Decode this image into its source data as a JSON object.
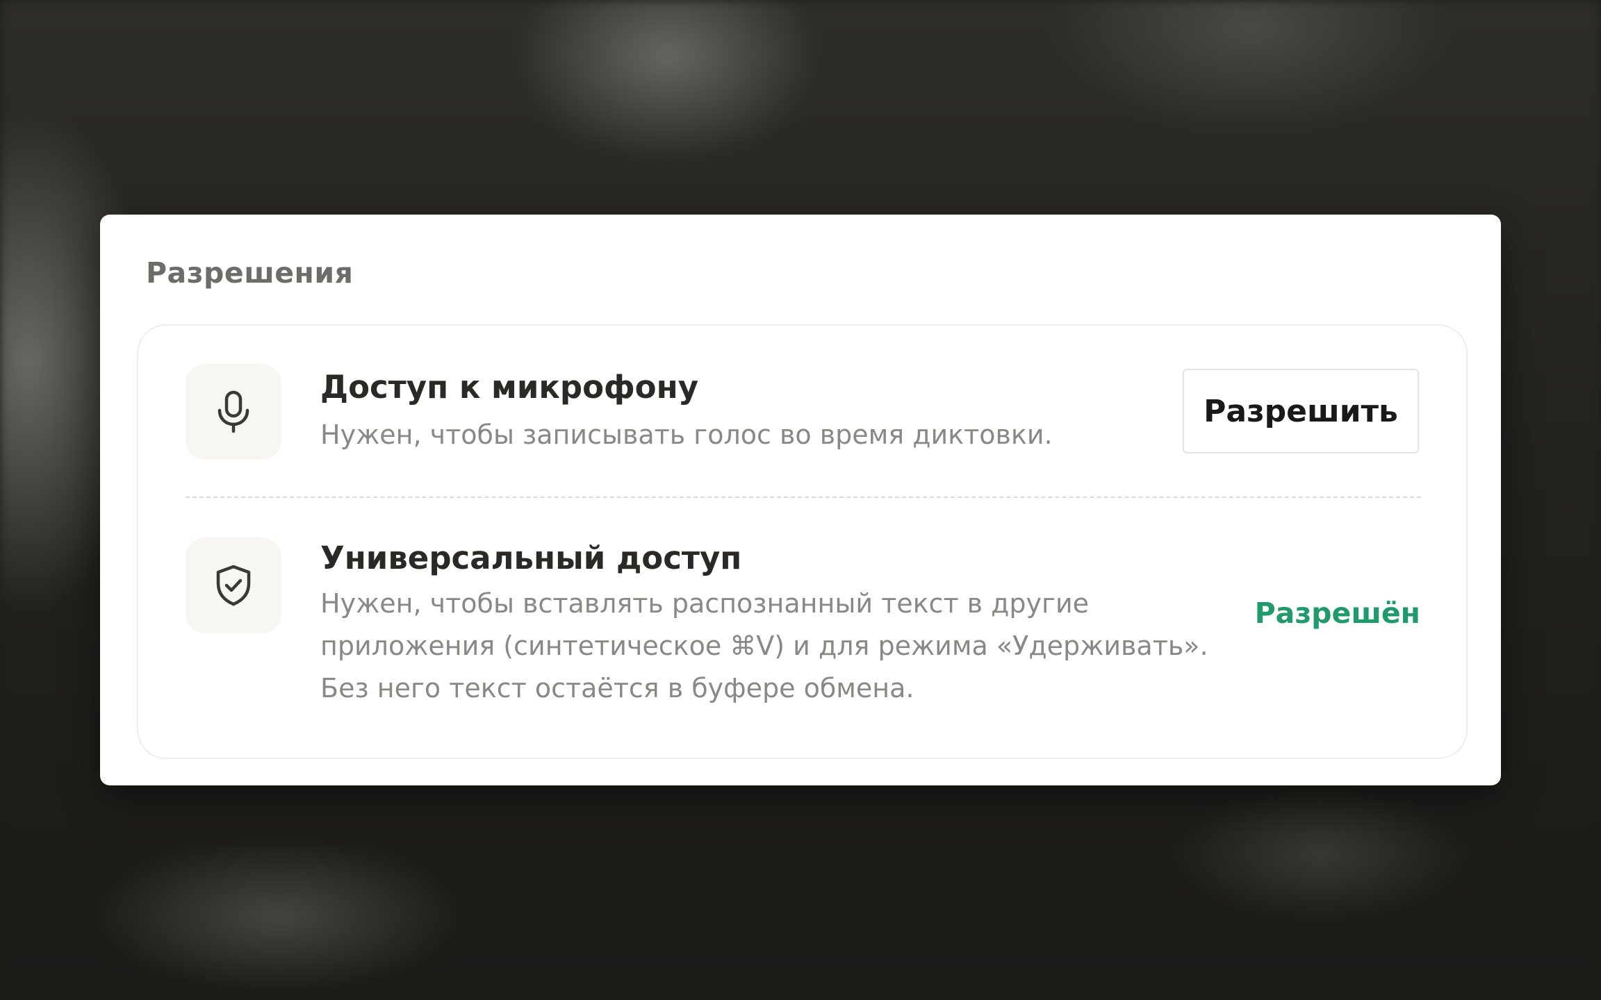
{
  "section": {
    "title": "Разрешения"
  },
  "permissions": [
    {
      "icon": "microphone-icon",
      "title": "Доступ к микрофону",
      "description": "Нужен, чтобы записывать голос во время диктовки.",
      "action_label": "Разрешить"
    },
    {
      "icon": "shield-check-icon",
      "title": "Универсальный доступ",
      "description_lines": [
        "Нужен, чтобы вставлять распознанный текст в другие",
        "приложения (синтетическое ⌘V) и для режима «Удерживать».",
        "Без него текст остаётся в буфере обмена."
      ],
      "status_label": "Разрешён",
      "status_color": "#1f9a6a"
    }
  ]
}
